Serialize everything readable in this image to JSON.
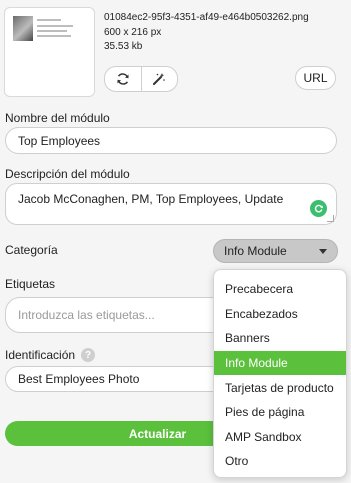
{
  "image": {
    "file_name": "01084ec2-95f3-4351-af49-e464b0503262.png",
    "dimensions": "600 x 216 px",
    "file_size": "35.53 kb",
    "refresh_icon": "refresh-icon",
    "magic_icon": "magic-wand-icon",
    "url_label": "URL"
  },
  "module_name": {
    "label": "Nombre del módulo",
    "value": "Top Employees"
  },
  "module_description": {
    "label": "Descripción del módulo",
    "value": "Jacob McConaghen, PM, Top Employees, Update"
  },
  "category": {
    "label": "Categoría",
    "selected": "Info Module",
    "options": [
      "Precabecera",
      "Encabezados",
      "Banners",
      "Info Module",
      "Tarjetas de producto",
      "Pies de página",
      "AMP Sandbox",
      "Otro"
    ],
    "active_index": 3
  },
  "tags": {
    "label": "Etiquetas",
    "placeholder": "Introduzca las etiquetas..."
  },
  "identification": {
    "label": "Identificación",
    "value": "Best Employees Photo"
  },
  "submit_label": "Actualizar",
  "colors": {
    "accent": "#5bc13d",
    "grammar": "#3bbf6e"
  }
}
